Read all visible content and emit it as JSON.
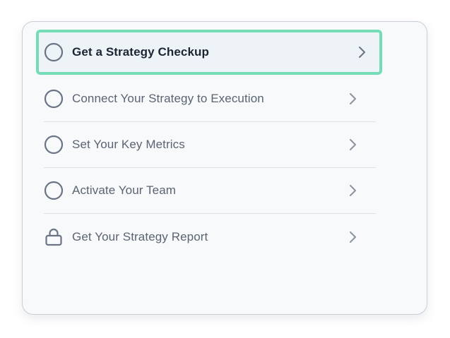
{
  "steps": [
    {
      "label": "Get a Strategy Checkup",
      "icon": "circle-icon",
      "active": true
    },
    {
      "label": "Connect Your Strategy to Execution",
      "icon": "circle-icon",
      "active": false
    },
    {
      "label": "Set Your Key Metrics",
      "icon": "circle-icon",
      "active": false
    },
    {
      "label": "Activate Your Team",
      "icon": "circle-icon",
      "active": false
    },
    {
      "label": "Get Your Strategy Report",
      "icon": "lock-icon",
      "active": false
    }
  ],
  "colors": {
    "highlight_border": "#74dcb6",
    "icon_stroke": "#6b7485",
    "active_text": "#1d2533",
    "muted_text": "#5b6472"
  }
}
